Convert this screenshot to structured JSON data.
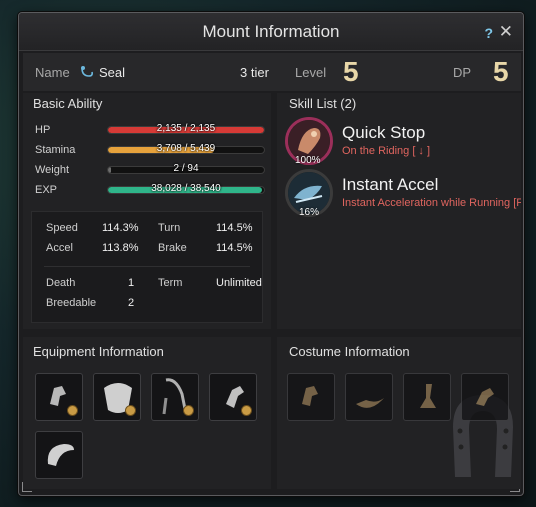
{
  "window": {
    "title": "Mount Information",
    "help": "?",
    "close": "✕"
  },
  "mount": {
    "name_label": "Name",
    "name": "Seal",
    "tier": "3 tier",
    "level_label": "Level",
    "level": "5",
    "dp_label": "DP",
    "dp": "5"
  },
  "basic_ability": {
    "heading": "Basic Ability",
    "bars": [
      {
        "label": "HP",
        "text": "2,135 / 2,135",
        "fraction": 1.0,
        "color": "#d63a36"
      },
      {
        "label": "Stamina",
        "text": "3,708 / 5,439",
        "fraction": 0.68,
        "color": "#e6a23c"
      },
      {
        "label": "Weight",
        "text": "2 / 94",
        "fraction": 0.02,
        "color": "#6d6d6d"
      },
      {
        "label": "EXP",
        "text": "38,028 / 38,540",
        "fraction": 0.987,
        "color": "#2fb58a"
      }
    ],
    "speed_label": "Speed",
    "speed": "114.3%",
    "turn_label": "Turn",
    "turn": "114.5%",
    "accel_label": "Accel",
    "accel": "113.8%",
    "brake_label": "Brake",
    "brake": "114.5%",
    "death_label": "Death",
    "death": "1",
    "term_label": "Term",
    "term": "Unlimited",
    "breedable_label": "Breedable",
    "breedable": "2"
  },
  "skill_list": {
    "heading": "Skill List (2)",
    "skills": [
      {
        "name": "Quick Stop",
        "desc": "On the Riding [ ↓ ]",
        "pct": "100%",
        "pct_value": 1.0
      },
      {
        "name": "Instant Accel",
        "desc": "Instant Acceleration while Running [F",
        "pct": "16%",
        "pct_value": 0.16
      }
    ]
  },
  "equipment": {
    "heading": "Equipment Information",
    "slots": [
      "horse-head-icon",
      "armor-icon",
      "stirrup-icon",
      "horseshoe-icon",
      "saddle-icon"
    ]
  },
  "costume": {
    "heading": "Costume Information",
    "slots": [
      "horse-head-icon",
      "saddle-icon",
      "stirrup-icon",
      "horseshoe-icon"
    ]
  },
  "colors": {
    "accent": "#e8d7a8",
    "skill_desc": "#e0655f",
    "slot_dot": "#c99b45"
  }
}
